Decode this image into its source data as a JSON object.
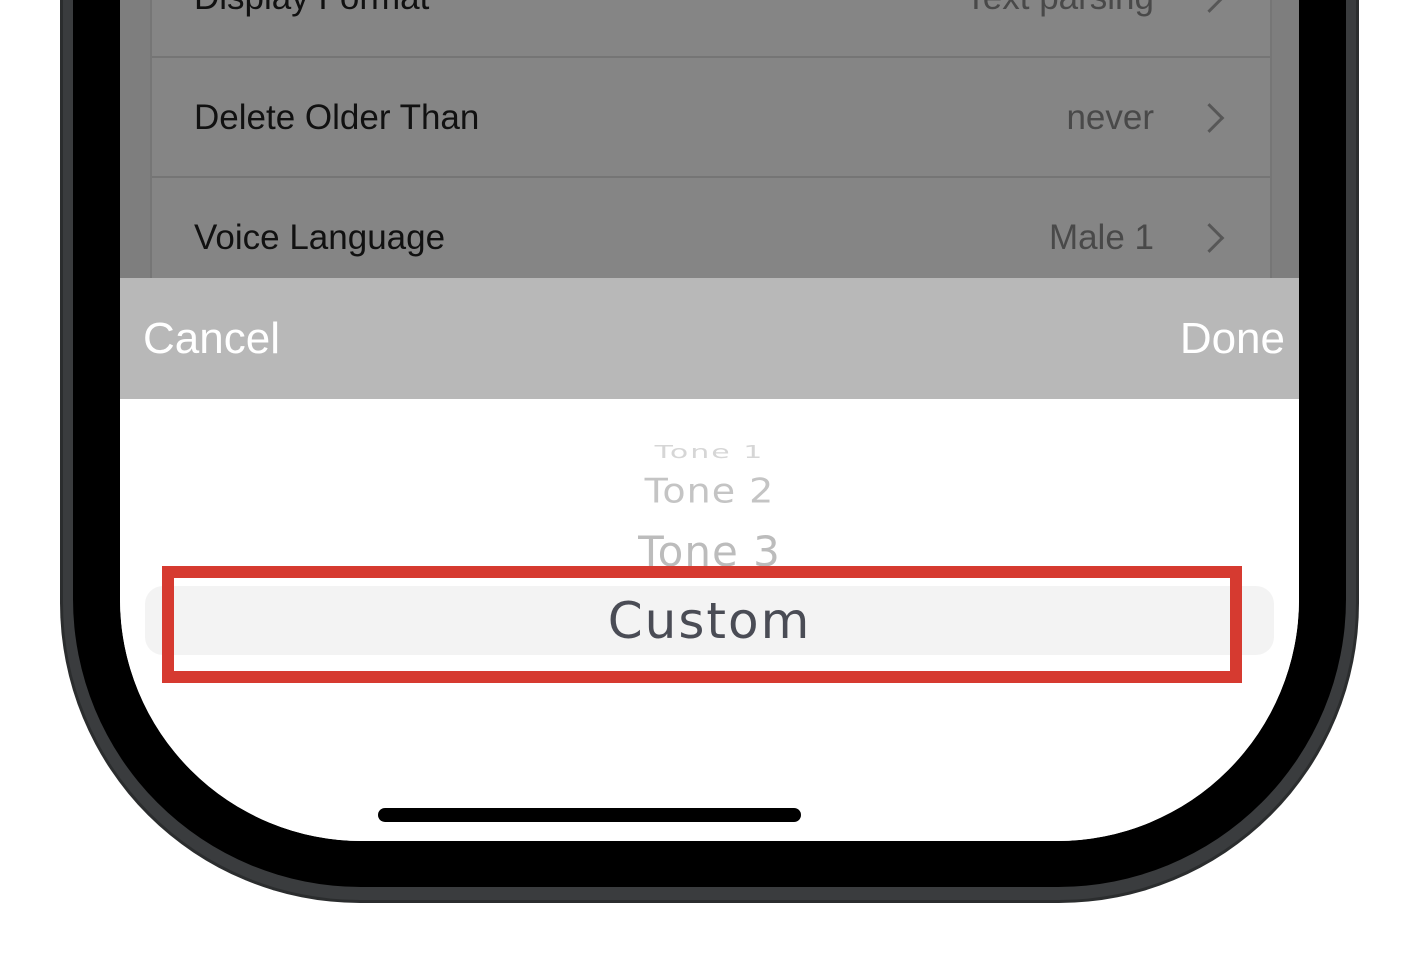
{
  "settings": {
    "rows": [
      {
        "label": "Display Format",
        "value": "Text parsing"
      },
      {
        "label": "Delete Older Than",
        "value": "never"
      },
      {
        "label": "Voice Language",
        "value": "Male 1"
      }
    ]
  },
  "picker": {
    "cancel_label": "Cancel",
    "done_label": "Done",
    "options": [
      "Tone 1",
      "Tone 2",
      "Tone 3",
      "Custom"
    ],
    "selected": "Custom"
  },
  "colors": {
    "highlight": "#d63a30",
    "toolbar": "#b8b8b8",
    "selected_text": "#4a4c55"
  }
}
